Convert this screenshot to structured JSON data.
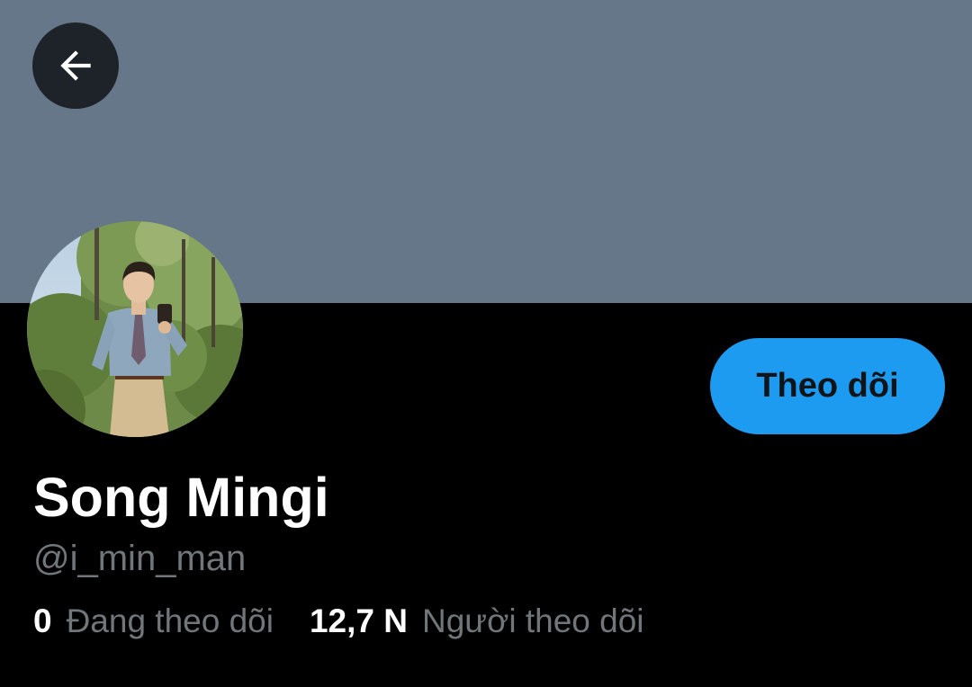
{
  "profile": {
    "display_name": "Song Mingi",
    "handle": "@i_min_man",
    "follow_button_label": "Theo dõi"
  },
  "stats": {
    "following_count": "0",
    "following_label": "Đang theo dõi",
    "followers_count": "12,7 N",
    "followers_label": "Người theo dõi"
  },
  "icons": {
    "back": "arrow-left-icon"
  },
  "colors": {
    "banner": "#66778a",
    "background": "#000000",
    "accent": "#1d9bf0",
    "secondary_text": "#71767b",
    "primary_text": "#ffffff"
  }
}
